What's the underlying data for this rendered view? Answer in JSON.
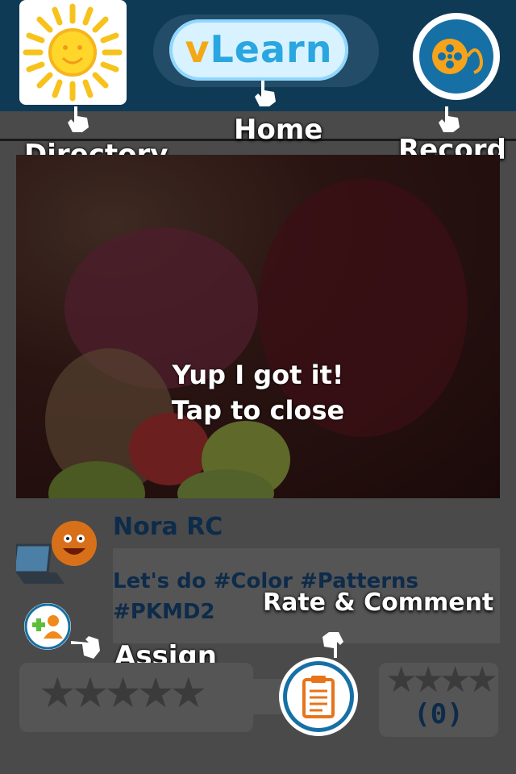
{
  "header": {
    "logo_prefix": "v",
    "logo_main": "Learn"
  },
  "labels": {
    "directory": "Directory",
    "home": "Home",
    "record": "Record",
    "assign": "Assign",
    "rate_comment": "Rate & Comment"
  },
  "video": {
    "overlay_line1": "Yup I got it!",
    "overlay_line2": "Tap to close"
  },
  "post": {
    "author": "Nora RC",
    "comment_line1": "Let's do #Color #Patterns",
    "comment_line2": "#PKMD2"
  },
  "rating": {
    "stars": "★★★★★",
    "summary_stars": "★★★★",
    "count": "(0)"
  },
  "colors": {
    "header_bg": "#0f3a55",
    "accent_blue": "#1670a5",
    "accent_orange": "#f5a31a",
    "text_navy": "#0d2b4a"
  },
  "icons": [
    "sun-icon",
    "film-reel-icon",
    "pointing-hand-icon",
    "clipboard-icon",
    "add-user-icon",
    "laptop-icon",
    "smiley-icon",
    "star-icon"
  ]
}
